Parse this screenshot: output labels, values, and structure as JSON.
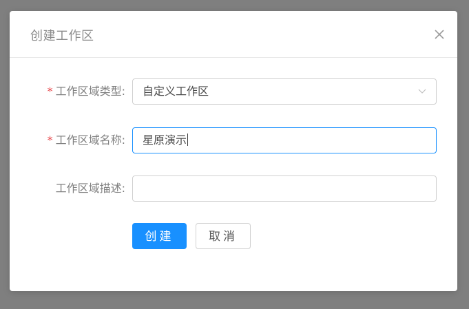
{
  "dialog": {
    "title": "创建工作区",
    "close_icon": "close-icon"
  },
  "form": {
    "type": {
      "required_mark": "*",
      "label": "工作区域类型:",
      "value": "自定义工作区",
      "icon": "chevron-down-icon"
    },
    "name": {
      "required_mark": "*",
      "label": "工作区域名称:",
      "value": "星原演示"
    },
    "description": {
      "label": "工作区域描述:",
      "value": ""
    }
  },
  "buttons": {
    "create": "创建",
    "cancel": "取消"
  },
  "colors": {
    "primary": "#1890ff",
    "required": "#e8474b",
    "overlay": "#7f7f7f"
  }
}
